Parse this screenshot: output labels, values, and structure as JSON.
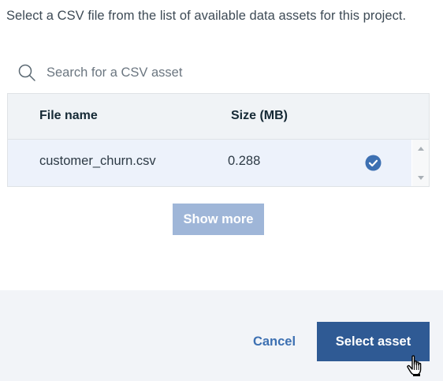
{
  "instruction": "Select a CSV file from the list of available data assets for this project.",
  "search": {
    "placeholder": "Search for a CSV asset",
    "value": "",
    "icon": "search-icon"
  },
  "table": {
    "columns": [
      "File name",
      "Size (MB)"
    ],
    "rows": [
      {
        "file_name": "customer_churn.csv",
        "size_mb": "0.288",
        "selected": true
      }
    ]
  },
  "buttons": {
    "show_more": "Show more",
    "cancel": "Cancel",
    "select_asset": "Select asset"
  },
  "colors": {
    "accent": "#3d70b2",
    "primary_button": "#2f5a94",
    "disabled_button": "#9fb6d8",
    "selected_row": "#edf2fb",
    "header_bg": "#f0f3f6",
    "footer_bg": "#f2f4f8"
  }
}
